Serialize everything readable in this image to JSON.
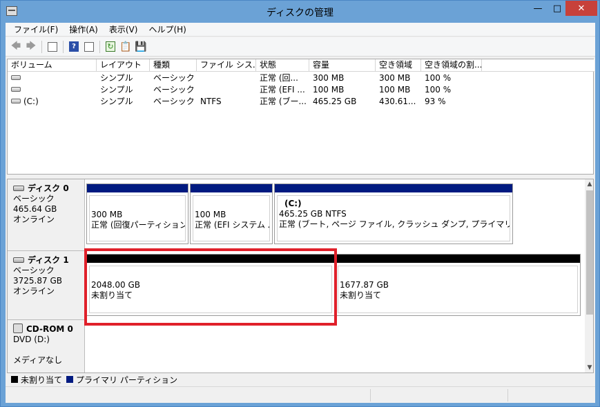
{
  "window": {
    "title": "ディスクの管理"
  },
  "menu": [
    {
      "label": "ファイル(F)"
    },
    {
      "label": "操作(A)"
    },
    {
      "label": "表示(V)"
    },
    {
      "label": "ヘルプ(H)"
    }
  ],
  "volumes": {
    "headers": [
      "ボリューム",
      "レイアウト",
      "種類",
      "ファイル シス...",
      "状態",
      "容量",
      "空き領域",
      "空き領域の割..."
    ],
    "rows": [
      {
        "volume": "",
        "layout": "シンプル",
        "type": "ベーシック",
        "fs": "",
        "status": "正常 (回...",
        "capacity": "300 MB",
        "free": "300 MB",
        "pct": "100 %"
      },
      {
        "volume": "",
        "layout": "シンプル",
        "type": "ベーシック",
        "fs": "",
        "status": "正常 (EFI ...",
        "capacity": "100 MB",
        "free": "100 MB",
        "pct": "100 %"
      },
      {
        "volume": "(C:)",
        "layout": "シンプル",
        "type": "ベーシック",
        "fs": "NTFS",
        "status": "正常 (ブー...",
        "capacity": "465.25 GB",
        "free": "430.61...",
        "pct": "93 %"
      }
    ]
  },
  "disks": [
    {
      "name": "ディスク 0",
      "kind": "ベーシック",
      "size": "465.64 GB",
      "state": "オンライン",
      "partitions": [
        {
          "name": "",
          "line1": "300 MB",
          "line2": "正常 (回復パーティション)"
        },
        {
          "name": "",
          "line1": "100 MB",
          "line2": "正常 (EFI システム パ"
        },
        {
          "name": "(C:)",
          "line1": "465.25 GB NTFS",
          "line2": "正常 (ブート, ページ ファイル, クラッシュ ダンプ, プライマリ パーティション"
        }
      ]
    },
    {
      "name": "ディスク 1",
      "kind": "ベーシック",
      "size": "3725.87 GB",
      "state": "オンライン",
      "partitions": [
        {
          "line1": "2048.00 GB",
          "line2": "未割り当て"
        },
        {
          "line1": "1677.87 GB",
          "line2": "未割り当て"
        }
      ]
    },
    {
      "name": "CD-ROM 0",
      "kind": "DVD (D:)",
      "size": "",
      "state": "メディアなし"
    }
  ],
  "legend": [
    {
      "label": "未割り当て",
      "color": "#000000"
    },
    {
      "label": "プライマリ パーティション",
      "color": "#001a80"
    }
  ],
  "colors": {
    "primary": "#001a80",
    "unallocated": "#000000",
    "highlight": "#e0202a",
    "titlebar": "#6ba2d6"
  },
  "icons": {
    "toolbar": [
      "back-arrow-icon",
      "forward-arrow-icon",
      "console-tree-icon",
      "help-icon",
      "show-hide-icon",
      "refresh-icon",
      "properties-icon",
      "disk-help-icon"
    ]
  }
}
